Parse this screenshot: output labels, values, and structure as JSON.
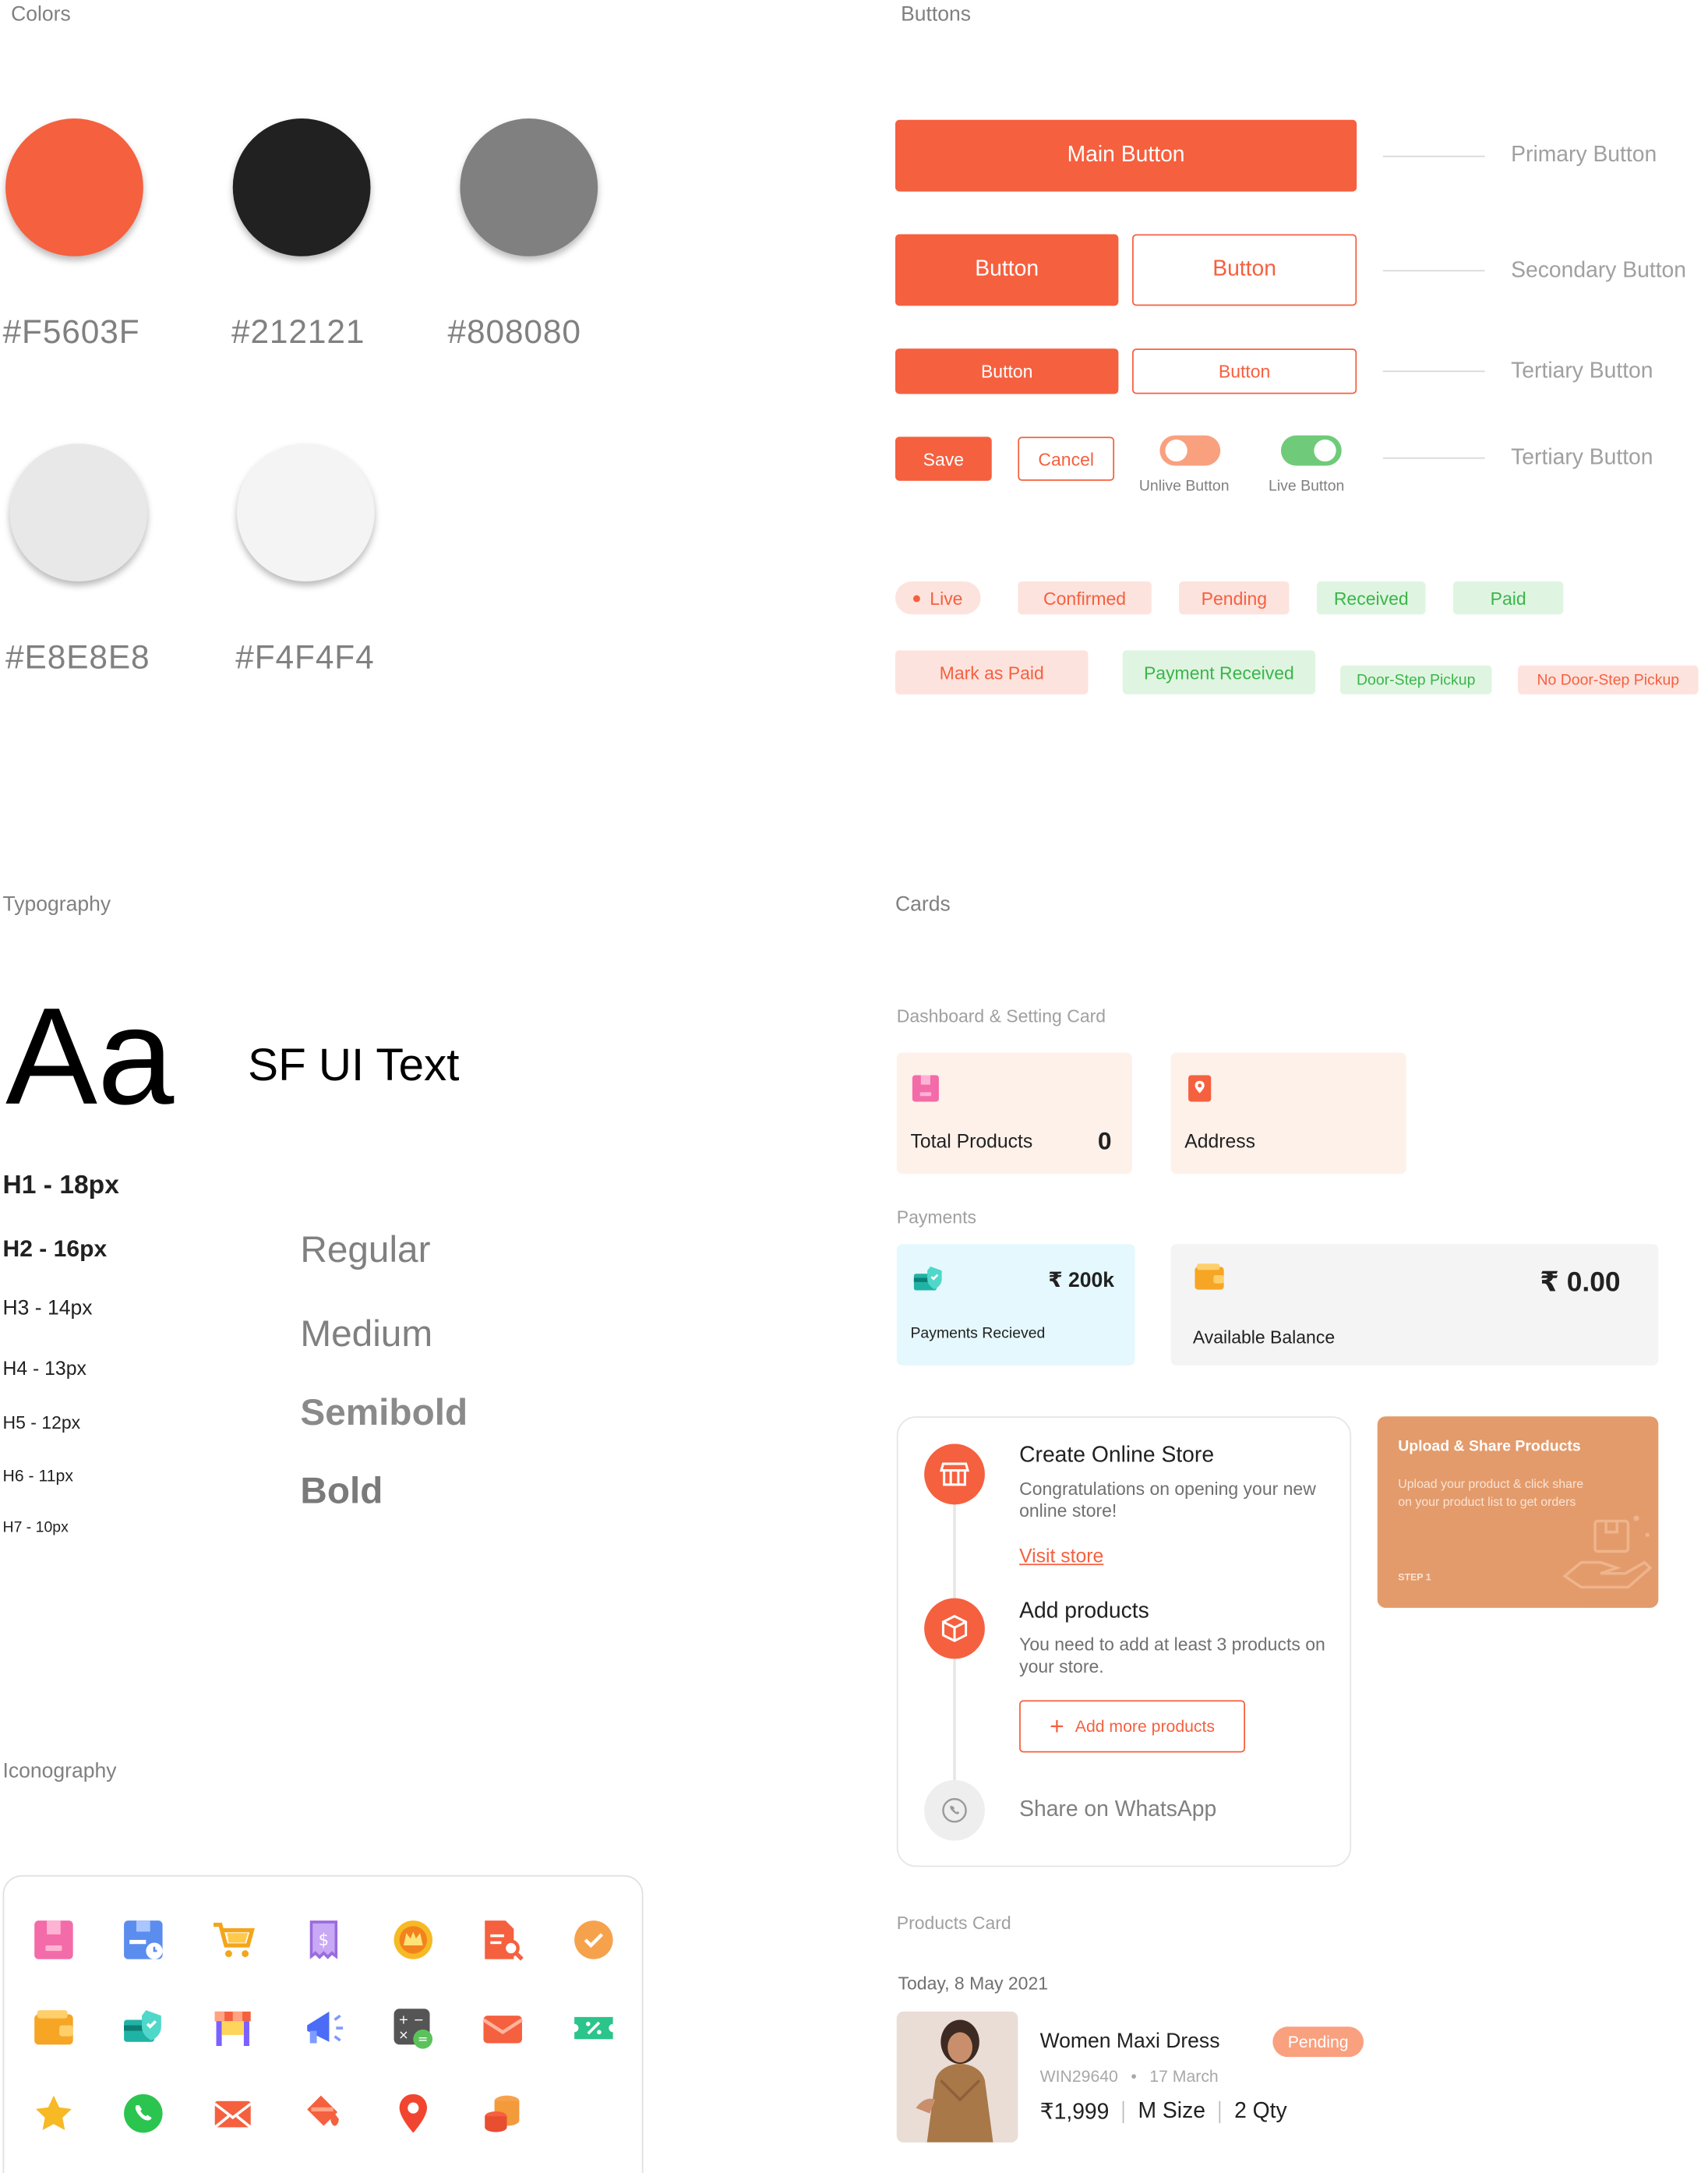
{
  "sections": {
    "colors": "Colors",
    "buttons": "Buttons",
    "typography": "Typography",
    "cards": "Cards",
    "iconography": "Iconography"
  },
  "colors": [
    {
      "hex": "#F5603F"
    },
    {
      "hex": "#212121"
    },
    {
      "hex": "#808080"
    },
    {
      "hex": "#E8E8E8"
    },
    {
      "hex": "#F4F4F4"
    }
  ],
  "buttons": {
    "main": "Main Button",
    "primary_label": "Primary Button",
    "secondary_fill": "Button",
    "secondary_outline": "Button",
    "secondary_label": "Secondary Button",
    "tertiary_fill": "Button",
    "tertiary_outline": "Button",
    "tertiary_label": "Tertiary Button",
    "save": "Save",
    "cancel": "Cancel",
    "unlive": "Unlive Button",
    "live": "Live Button",
    "tertiary_label_2": "Tertiary Button",
    "toggle_unlive_color": "#F9A07F",
    "toggle_live_color": "#6FCB7A"
  },
  "badges": {
    "live": "Live",
    "confirmed": "Confirmed",
    "pending": "Pending",
    "received": "Received",
    "paid": "Paid",
    "mark_paid": "Mark as Paid",
    "payment_received": "Payment Received",
    "doorstep": "Door-Step Pickup",
    "no_doorstep": "No Door-Step Pickup"
  },
  "typography": {
    "sample": "Aa",
    "font_name": "SF UI Text",
    "h1": "H1 - 18px",
    "h2": "H2 - 16px",
    "h3": "H3 - 14px",
    "h4": "H4 - 13px",
    "h5": "H5 - 12px",
    "h6": "H6 - 11px",
    "h7": "H7 - 10px",
    "regular": "Regular",
    "medium": "Medium",
    "semibold": "Semibold",
    "bold": "Bold"
  },
  "cards": {
    "dashboard_label": "Dashboard & Setting Card",
    "total_products": "Total Products",
    "total_products_value": "0",
    "address": "Address",
    "payments_label": "Payments",
    "payments_received_value": "₹ 200k",
    "payments_received": "Payments Recieved",
    "available_balance_value": "₹ 0.00",
    "available_balance": "Available Balance",
    "create_store_title": "Create Online Store",
    "create_store_desc": "Congratulations on opening your new online store!",
    "visit_store": "Visit store",
    "add_products_title": "Add products",
    "add_products_desc": "You need to add at least 3 products on your store.",
    "add_more": "Add more products",
    "share_whatsapp": "Share on WhatsApp",
    "upload_title": "Upload & Share Products",
    "upload_desc": "Upload your product & click share on your product list to get orders",
    "upload_step": "STEP 1",
    "products_card_label": "Products Card",
    "date": "Today, 8 May 2021",
    "product_name": "Women Maxi Dress",
    "product_status": "Pending",
    "order_id": "WIN29640",
    "order_date": "17 March",
    "price": "₹1,999",
    "size": "M Size",
    "qty": "2 Qty"
  },
  "icons": [
    "box-icon",
    "box-clock-icon",
    "cart-icon",
    "receipt-icon",
    "crown-icon",
    "document-search-icon",
    "check-circle-icon",
    "wallet-icon",
    "payment-check-icon",
    "store-icon",
    "megaphone-icon",
    "calculator-icon",
    "envelope-icon",
    "discount-ticket-icon",
    "star-icon",
    "whatsapp-icon",
    "mail-icon",
    "paint-bucket-icon",
    "location-pin-icon",
    "coins-icon"
  ]
}
